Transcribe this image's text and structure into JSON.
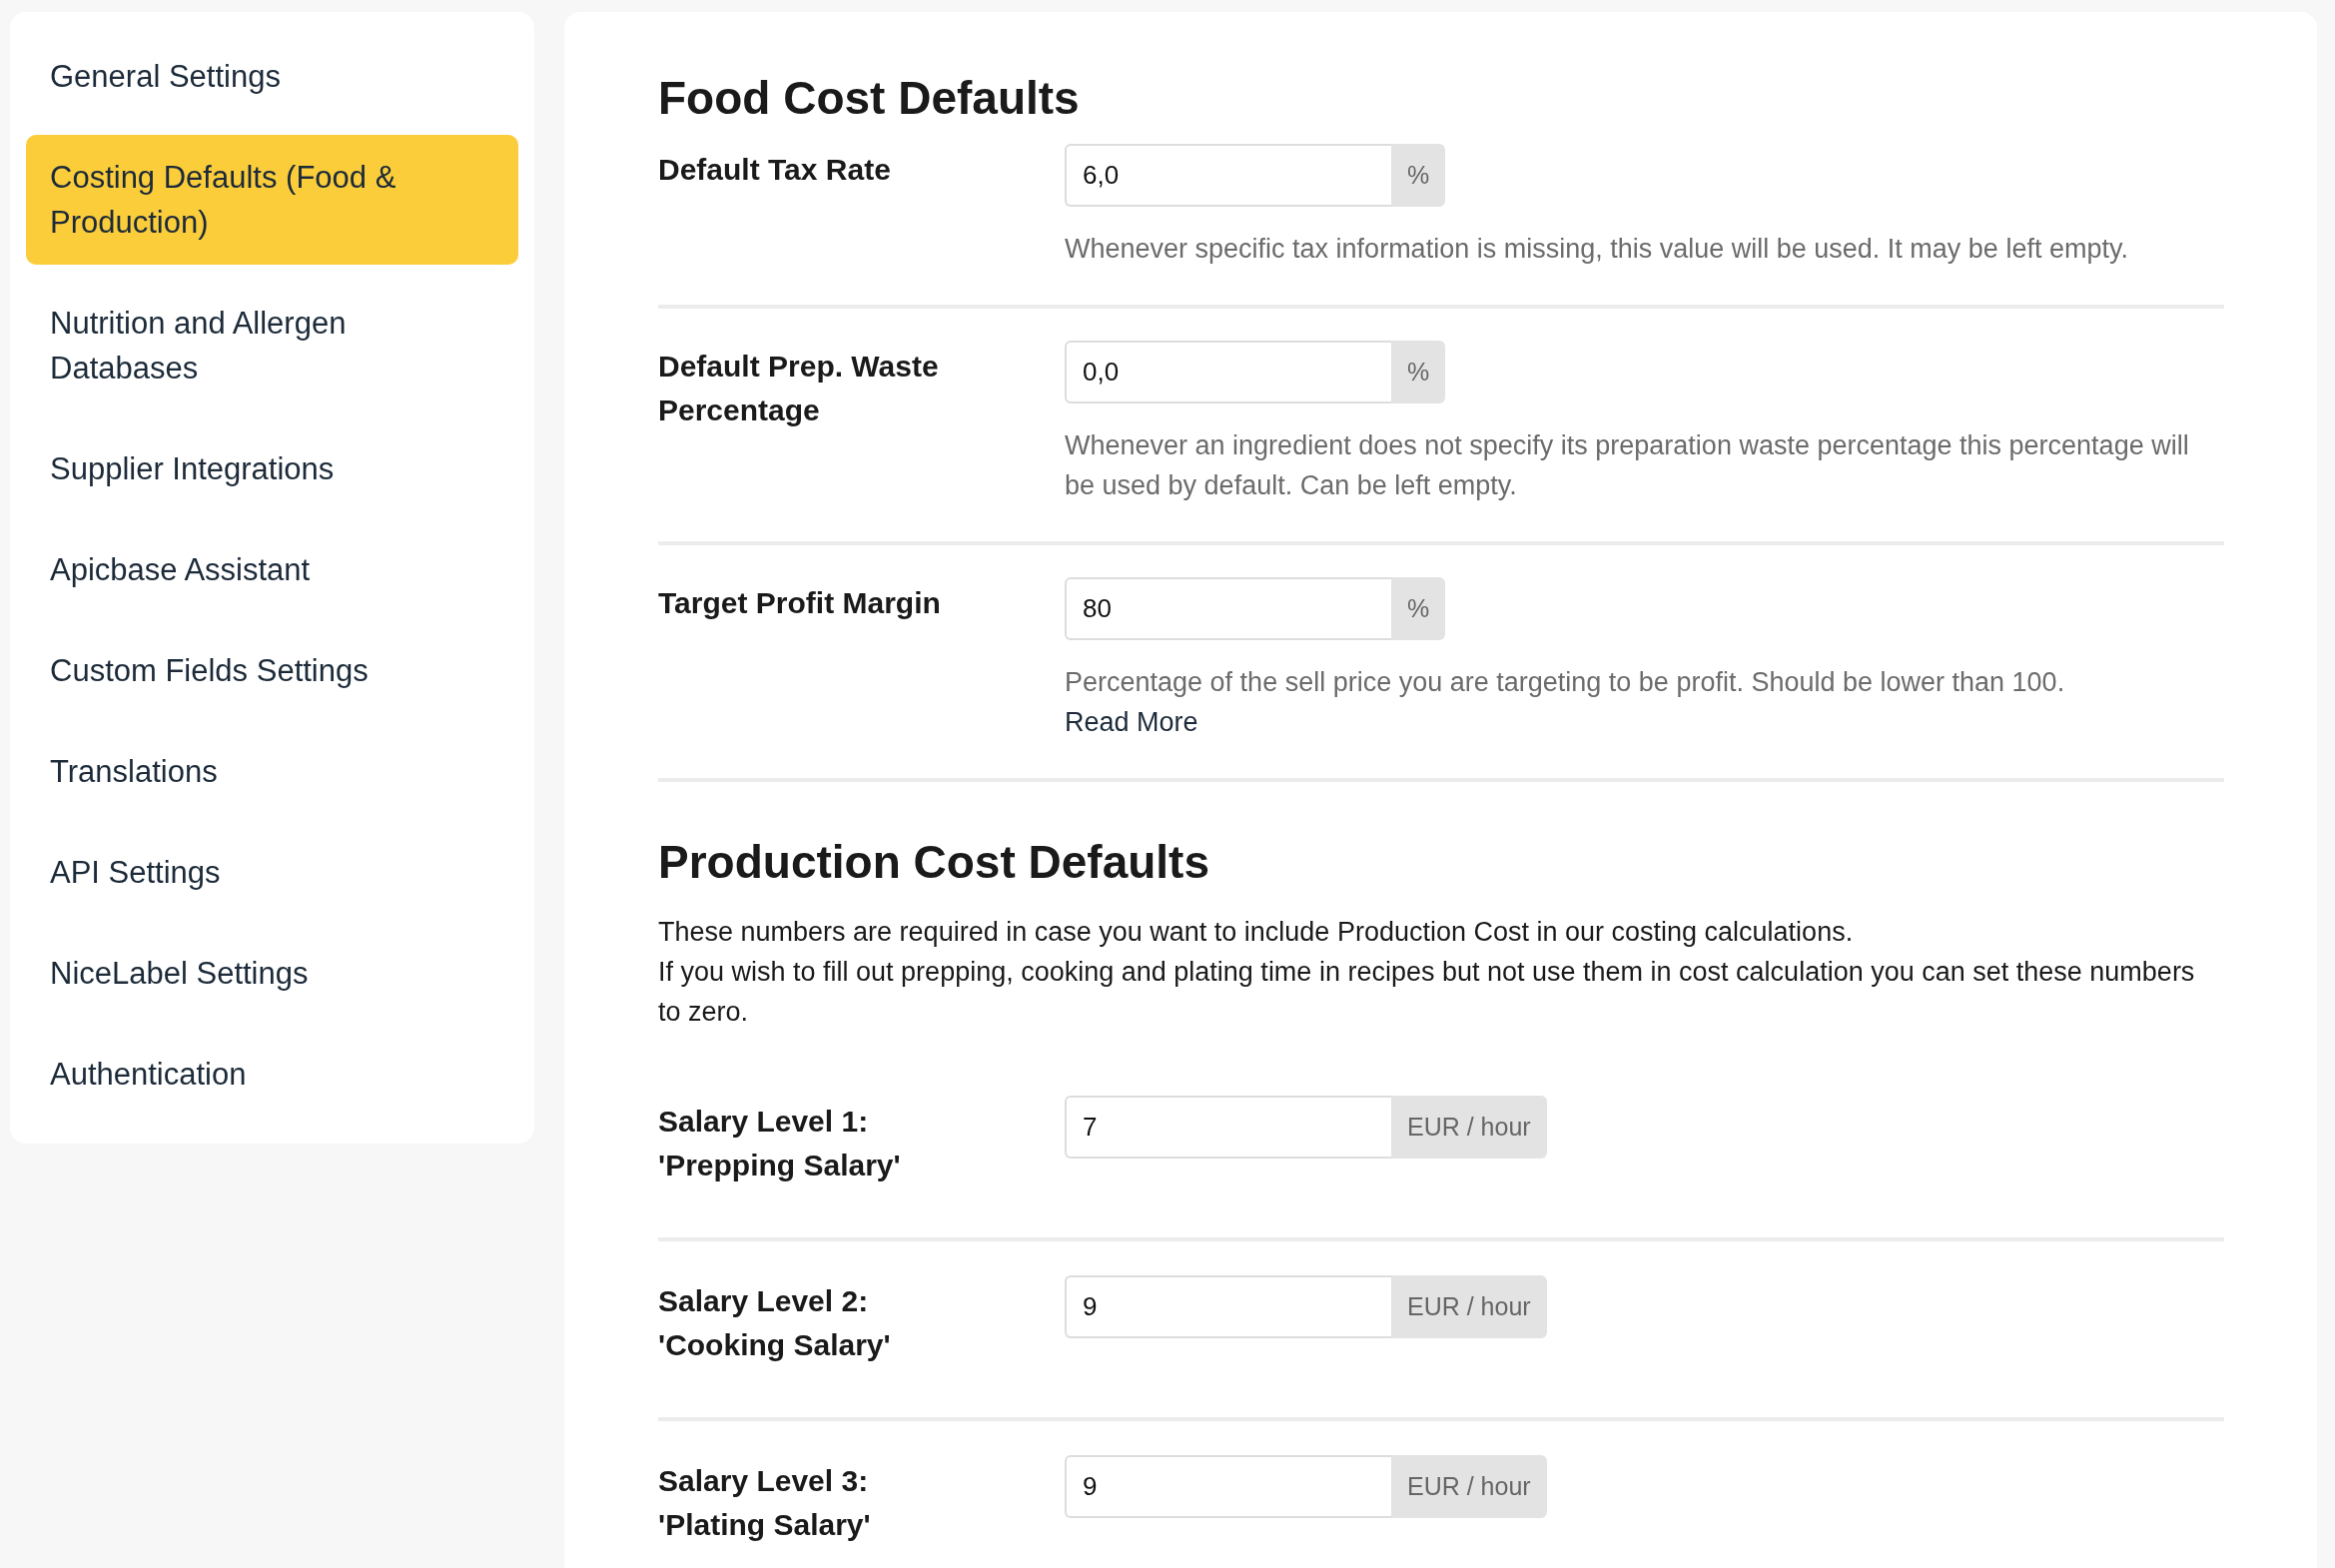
{
  "sidebar": {
    "items": [
      {
        "label": "General Settings",
        "selected": false
      },
      {
        "label": "Costing Defaults (Food & Production)",
        "selected": true
      },
      {
        "label": "Nutrition and Allergen Databases",
        "selected": false
      },
      {
        "label": "Supplier Integrations",
        "selected": false
      },
      {
        "label": "Apicbase Assistant",
        "selected": false
      },
      {
        "label": "Custom Fields Settings",
        "selected": false
      },
      {
        "label": "Translations",
        "selected": false
      },
      {
        "label": "API Settings",
        "selected": false
      },
      {
        "label": "NiceLabel Settings",
        "selected": false
      },
      {
        "label": "Authentication",
        "selected": false
      }
    ]
  },
  "food_cost": {
    "title": "Food Cost Defaults",
    "fields": [
      {
        "label": "Default Tax Rate",
        "value": "6,0",
        "unit": "%",
        "help": "Whenever specific tax information is missing, this value will be used. It may be left empty."
      },
      {
        "label": "Default Prep. Waste\nPercentage",
        "value": "0,0",
        "unit": "%",
        "help": "Whenever an ingredient does not specify its preparation waste percentage this percentage will be used by default. Can be left empty."
      },
      {
        "label": "Target Profit Margin",
        "value": "80",
        "unit": "%",
        "help": "Percentage of the sell price you are targeting to be profit. Should be lower than 100.",
        "link": "Read More"
      }
    ]
  },
  "production_cost": {
    "title": "Production Cost Defaults",
    "paragraphs": [
      "These numbers are required in case you want to include Production Cost in our costing calculations.",
      "If you wish to fill out prepping, cooking and plating time in recipes but not use them in cost calculation you can set these numbers to zero."
    ],
    "fields": [
      {
        "label": "Salary Level 1:\n'Prepping Salary'",
        "value": "7",
        "unit": "EUR / hour"
      },
      {
        "label": "Salary Level 2:\n'Cooking Salary'",
        "value": "9",
        "unit": "EUR / hour"
      },
      {
        "label": "Salary Level 3:\n'Plating Salary'",
        "value": "9",
        "unit": "EUR / hour"
      }
    ]
  }
}
